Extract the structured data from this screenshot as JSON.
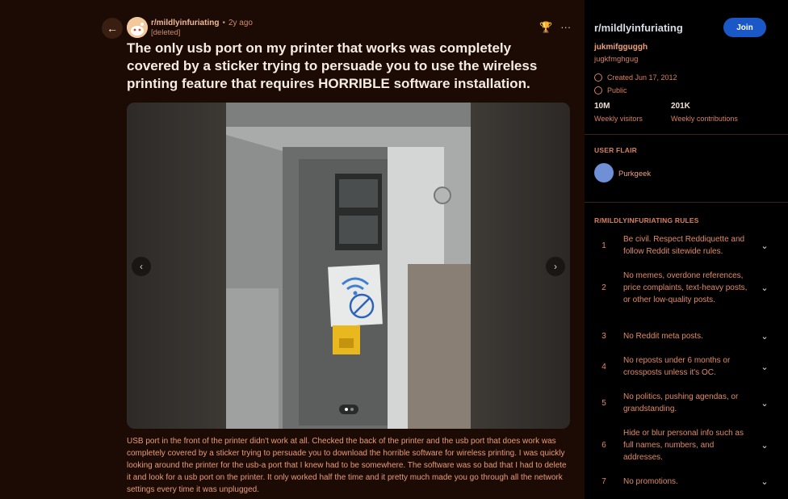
{
  "post": {
    "subreddit": "r/mildlyinfuriating",
    "separator": "•",
    "age": "2y ago",
    "author": "[deleted]",
    "title": "The only usb port on my printer that works was completely covered by a sticker trying to persuade you to use the wireless printing feature that requires HORRIBLE software installation.",
    "caption": "USB port in the front of the printer didn't work at all. Checked the back of the printer and the usb port that does work was completely covered by a sticker trying to persuade you to download the horrible software for wireless printing. I was quickly looking around the printer for the usb-a port that I knew had to be somewhere. The software was so bad that I had to delete it and look for a usb port on the printer. It only worked half the time and it pretty much made you go through all the network settings every time it was unplugged.",
    "icons": {
      "back": "back-arrow-icon",
      "award": "award-icon",
      "more": "more-icon"
    },
    "gallery": {
      "prev": "chevron-left-icon",
      "next": "chevron-right-icon",
      "count": 2,
      "active": 0
    }
  },
  "sidebar": {
    "subreddit": "r/mildlyinfuriating",
    "join_label": "Join",
    "title": "jukmifgguggh",
    "description": "jugkfmghgug",
    "created": "Created Jun 17, 2012",
    "visibility": "Public",
    "stats": [
      {
        "value": "10M",
        "label": "Weekly visitors"
      },
      {
        "value": "201K",
        "label": "Weekly contributions"
      }
    ],
    "flair_heading": "USER FLAIR",
    "flair_name": "Purkgeek",
    "rules_heading": "R/MILDLYINFURIATING RULES",
    "rules": [
      {
        "num": "1",
        "text": "Be civil. Respect Reddiquette and follow Reddit sitewide rules."
      },
      {
        "num": "2",
        "text": "No memes, overdone references, price complaints, text-heavy posts, or other low-quality posts."
      },
      {
        "num": "3",
        "text": "No Reddit meta posts."
      },
      {
        "num": "4",
        "text": "No reposts under 6 months or crossposts unless it's OC."
      },
      {
        "num": "5",
        "text": "No politics, pushing agendas, or grandstanding."
      },
      {
        "num": "6",
        "text": "Hide or blur personal info such as full names, numbers, and addresses."
      },
      {
        "num": "7",
        "text": "No promotions."
      }
    ]
  }
}
